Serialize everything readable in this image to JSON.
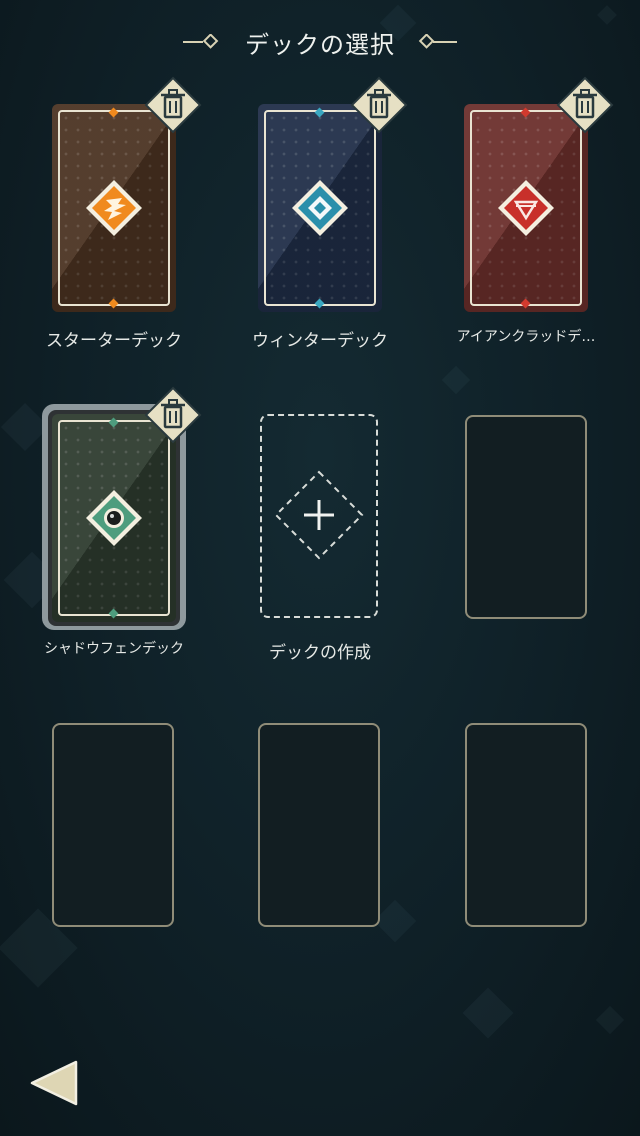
{
  "header": {
    "title": "デックの選択"
  },
  "colors": {
    "card_frame": "#e9e4d2",
    "empty_border": "#8f8c78",
    "trash_badge": "#e6e0c4",
    "background": "#0f2027"
  },
  "decks": [
    {
      "name": "スターターデック",
      "color": "#4a3221",
      "accent": "#f08a1e",
      "emblem": "flame-emblem-icon"
    },
    {
      "name": "ウィンターデック",
      "color": "#1f2d47",
      "accent": "#3aa7c0",
      "emblem": "snow-emblem-icon"
    },
    {
      "name": "アイアンクラッドデ…",
      "color": "#6a2e2b",
      "accent": "#d23a2e",
      "emblem": "gem-emblem-icon"
    },
    {
      "name": "シャドウフェンデック",
      "color": "#2d3a2e",
      "accent": "#4e9d7e",
      "emblem": "eye-emblem-icon",
      "selected": true
    }
  ],
  "create_deck": {
    "label": "デックの作成",
    "icon": "plus-icon"
  },
  "empty_slot_count": 4,
  "icons": {
    "trash": "trash-icon",
    "back": "back-arrow-icon"
  }
}
